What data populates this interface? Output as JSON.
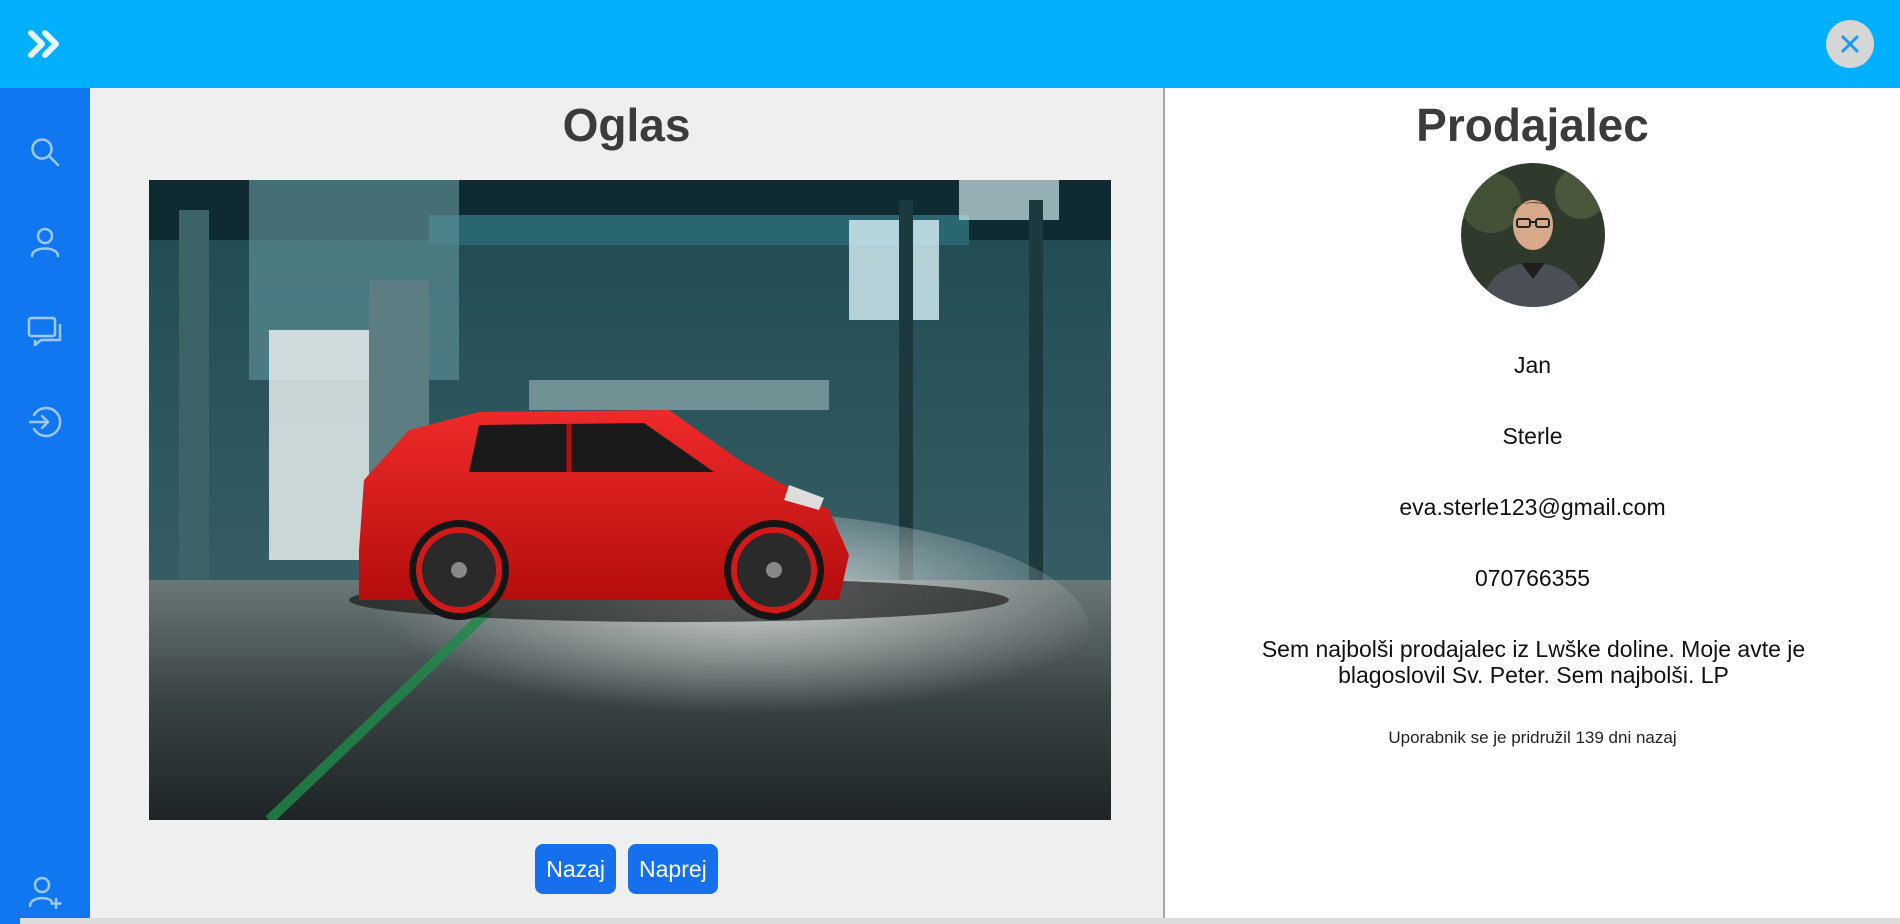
{
  "topbar": {
    "color": "#00b0ff",
    "expand_icon": "chevrons-right-icon",
    "close_icon": "close-icon",
    "close_label": "X"
  },
  "sidebar": {
    "color": "#1077f0",
    "items": [
      {
        "icon": "search-icon"
      },
      {
        "icon": "user-icon"
      },
      {
        "icon": "chat-icon"
      },
      {
        "icon": "login-icon"
      },
      {
        "icon": "add-user-icon"
      }
    ]
  },
  "listing": {
    "title": "Oglas",
    "image_alt": "red hatchback car in industrial hall",
    "prev_label": "Nazaj",
    "next_label": "Naprej"
  },
  "seller": {
    "title": "Prodajalec",
    "first_name": "Jan",
    "last_name": "Sterle",
    "email": "eva.sterle123@gmail.com",
    "phone": "070766355",
    "bio": "Sem najbolši prodajalec iz Lwške doline. Moje avte je blagoslovil Sv. Peter. Sem najbolši. LP",
    "joined": "Uporabnik se je pridružil 139 dni nazaj"
  }
}
